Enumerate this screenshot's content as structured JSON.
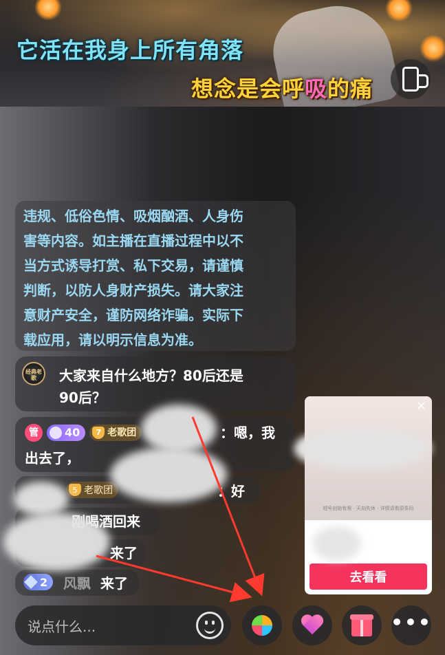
{
  "video": {
    "lyric_line1": "它活在我身上所有角落",
    "lyric_line2_a": "想念是会呼",
    "lyric_line2_b": "吸",
    "lyric_line2_c": "的痛"
  },
  "notice": {
    "lines": [
      "违规、低俗色情、吸烟酗酒、人身伤",
      "害等内容。如主播在直播过程中以不",
      "当方式诱导打赏、私下交易，请谨慎",
      "判断，以防人身财产损失。请大家注",
      "意财产安全，谨防网络诈骗。实际下",
      "载应用，请以明示信息为准。"
    ]
  },
  "chat": {
    "question_avatar_text": "经典老歌",
    "question_line1": "大家来自什么地方？80后还是",
    "question_line2": "90后？",
    "msg1_badge_admin": "管",
    "msg1_badge_level": "40",
    "msg1_badge_group_num": "7",
    "msg1_badge_group": "老歌团",
    "msg1_text_tail": "：嗯，我",
    "msg1_text_line2": "出去了，",
    "msg2_badge_group_num": "5",
    "msg2_badge_group": "老歌团",
    "msg2_text_tail": "：好",
    "msg3_text": "刚喝酒回来",
    "msg4_text": "来了",
    "msg5_badge_level": "2",
    "msg5_name": "风飘",
    "msg5_text": "来了"
  },
  "ad": {
    "close": "✕",
    "small_text": "短号创始有限 · 天刻先休 · 详情请看原条码",
    "button_label": "去看看"
  },
  "bottom": {
    "input_placeholder": "说点什么..."
  },
  "colors": {
    "notice_text": "#9bd8f2",
    "ad_button": "#f5345e",
    "arrow": "#ff3b30"
  }
}
